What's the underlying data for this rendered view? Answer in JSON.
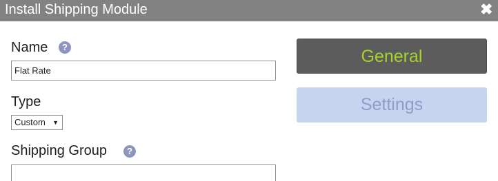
{
  "dialog": {
    "title": "Install Shipping Module",
    "close_glyph": "✖"
  },
  "form": {
    "name_label": "Name",
    "name_value": "Flat Rate",
    "type_label": "Type",
    "type_value": "Custom",
    "shipping_group_label": "Shipping Group",
    "shipping_group_value": "",
    "help_glyph": "?"
  },
  "side_tabs": {
    "general_label": "General",
    "settings_label": "Settings"
  },
  "icons": {
    "close": "close-icon",
    "help": "help-icon",
    "dropdown": "triangle-down-icon"
  },
  "colors": {
    "titlebar": "#828282",
    "general_bg": "#5c5c5c",
    "general_text": "#a6d42a",
    "settings_bg": "#c8d3ef",
    "settings_text": "#8c9ec9",
    "help_icon": "#8d96bf"
  }
}
